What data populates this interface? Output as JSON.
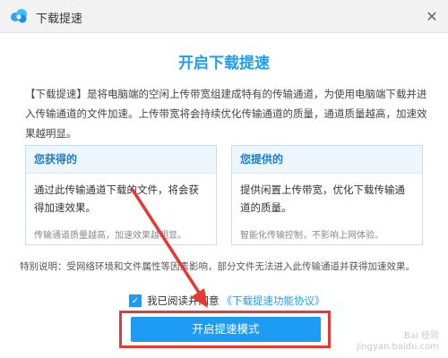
{
  "window": {
    "title": "下载提速",
    "close_label": "✕",
    "close_icon": "close-icon",
    "logo_icon": "cloud-logo-icon"
  },
  "main": {
    "heading": "开启下载提速",
    "description": "【下载提速】是将电脑端的空闲上传带宽组建成特有的传输通道，为使用电脑端下载并进入传输通道的文件加速。上传带宽将会持续优化传输通道的质量，通道质量越高，加速效果越明显。"
  },
  "cards": {
    "gain": {
      "title": "您获得的",
      "body": "通过此传输通道下载的文件，将会获得加速效果。",
      "note": "传输通道质量越高，加速效果越明显。"
    },
    "provide": {
      "title": "您提供的",
      "body": "提供闲置上传带宽，优化下载传输通道的质量。",
      "note": "智能化传输控制，不影响上网体验。"
    }
  },
  "notice": "特别说明：受网络环境和文件属性等因素影响，部分文件无法进入此传输通道并获得加速效果。",
  "agreement": {
    "checked": true,
    "check_mark": "✓",
    "label": "我已阅读并同意",
    "link": "《下载提速功能协议》"
  },
  "cta": {
    "label": "开启提速模式"
  },
  "watermark": {
    "line1": "Bai 经验",
    "line2": "jingyan.baidu.com"
  },
  "colors": {
    "accent": "#1e9cf5",
    "annotation_red": "#e53935"
  }
}
